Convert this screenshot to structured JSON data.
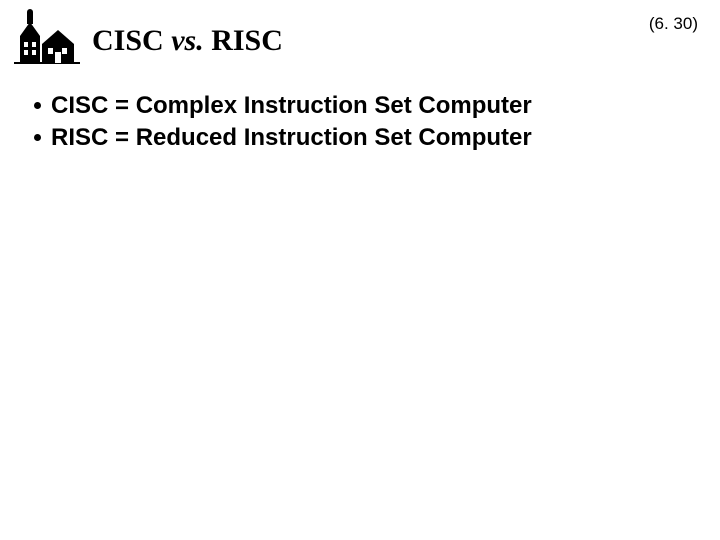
{
  "page_number": "(6. 30)",
  "title_part1": "CISC ",
  "title_vs": "vs.",
  "title_part2": " RISC",
  "bullets": [
    "CISC = Complex Instruction Set Computer",
    "RISC = Reduced Instruction Set Computer"
  ]
}
